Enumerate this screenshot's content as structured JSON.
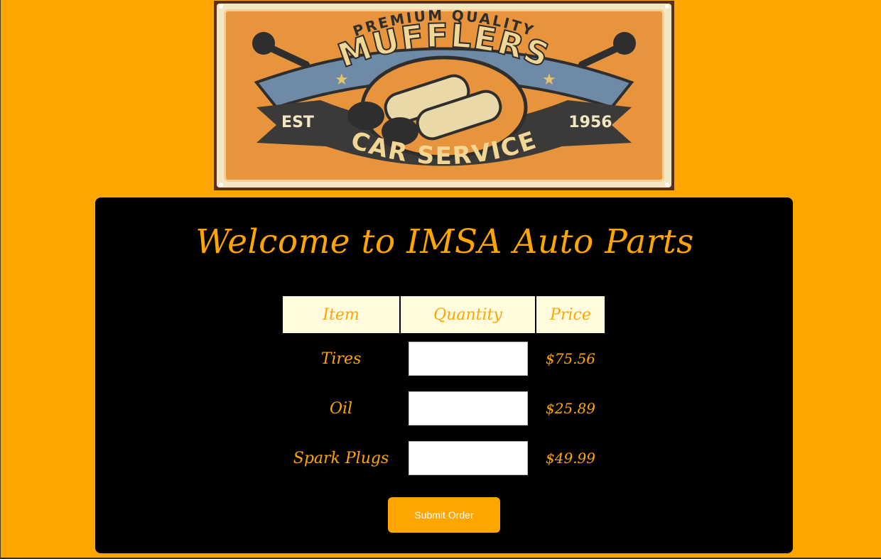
{
  "logo": {
    "top_text": "PREMIUM QUALITY",
    "banner_text": "MUFFLERS",
    "est_label": "EST",
    "year": "1956",
    "bottom_text": "CAR SERVICE"
  },
  "page": {
    "title": "Welcome to IMSA Auto Parts"
  },
  "table": {
    "headers": [
      "Item",
      "Quantity",
      "Price"
    ],
    "rows": [
      {
        "item": "Tires",
        "quantity": "",
        "price": "$75.56"
      },
      {
        "item": "Oil",
        "quantity": "",
        "price": "$25.89"
      },
      {
        "item": "Spark Plugs",
        "quantity": "",
        "price": "$49.99"
      }
    ]
  },
  "submit": {
    "label": "Submit Order"
  },
  "colors": {
    "background": "#ffa500",
    "panel": "#000000",
    "accent": "#ffa500",
    "header_cell": "#fffbdc"
  }
}
